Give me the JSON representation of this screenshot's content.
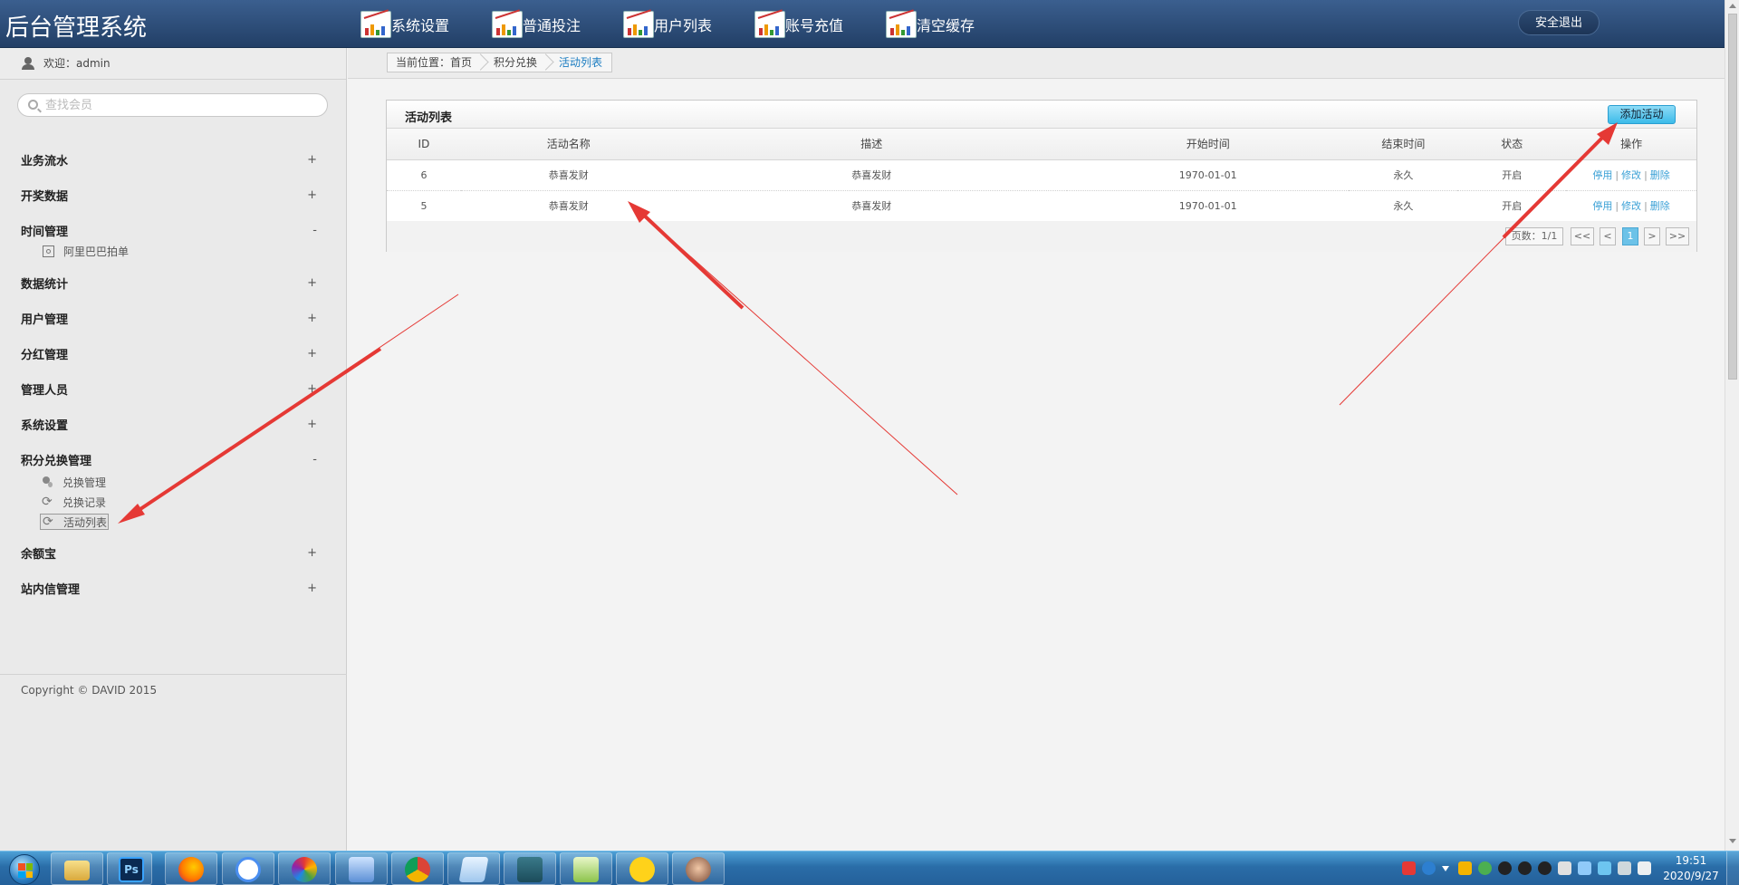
{
  "header": {
    "logo": "后台管理系统",
    "nav": [
      {
        "label": "系统设置"
      },
      {
        "label": "普通投注"
      },
      {
        "label": "用户列表"
      },
      {
        "label": "账号充值"
      },
      {
        "label": "清空缓存"
      }
    ],
    "logout_label": "安全退出"
  },
  "sidebar": {
    "welcome": "欢迎：admin",
    "search_placeholder": "查找会员",
    "menu": [
      {
        "label": "业务流水",
        "toggle": "+",
        "items": []
      },
      {
        "label": "开奖数据",
        "toggle": "+",
        "items": []
      },
      {
        "label": "时间管理",
        "toggle": "-",
        "items": [
          {
            "label": "阿里巴巴拍单",
            "icon": "target-icon"
          }
        ]
      },
      {
        "label": "数据统计",
        "toggle": "+",
        "items": []
      },
      {
        "label": "用户管理",
        "toggle": "+",
        "items": []
      },
      {
        "label": "分红管理",
        "toggle": "+",
        "items": []
      },
      {
        "label": "管理人员",
        "toggle": "+",
        "items": []
      },
      {
        "label": "系统设置",
        "toggle": "+",
        "items": []
      },
      {
        "label": "积分兑换管理",
        "toggle": "-",
        "items": [
          {
            "label": "兑换管理",
            "icon": "pin-icon"
          },
          {
            "label": "兑换记录",
            "icon": "refresh-icon"
          },
          {
            "label": "活动列表",
            "icon": "refresh-icon",
            "active": true
          }
        ]
      },
      {
        "label": "余额宝",
        "toggle": "+",
        "items": []
      },
      {
        "label": "站内信管理",
        "toggle": "+",
        "items": []
      }
    ],
    "copyright": "Copyright © DAVID 2015"
  },
  "breadcrumb": {
    "items": [
      "当前位置：首页",
      "积分兑换",
      "活动列表"
    ]
  },
  "panel": {
    "title": "活动列表",
    "add_button": "添加活动",
    "columns": [
      "ID",
      "活动名称",
      "描述",
      "开始时间",
      "结束时间",
      "状态",
      "操作"
    ],
    "rows": [
      {
        "id": "6",
        "name": "恭喜发财",
        "desc": "恭喜发财",
        "start": "1970-01-01",
        "end": "永久",
        "status": "开启",
        "ops": [
          "停用",
          "修改",
          "删除"
        ]
      },
      {
        "id": "5",
        "name": "恭喜发财",
        "desc": "恭喜发财",
        "start": "1970-01-01",
        "end": "永久",
        "status": "开启",
        "ops": [
          "停用",
          "修改",
          "删除"
        ]
      }
    ],
    "pager": {
      "info": "页数：1/1",
      "first": "<<",
      "prev": "<",
      "current": "1",
      "next": ">",
      "last": ">>"
    }
  },
  "taskbar": {
    "time": "19:51",
    "date": "2020/9/27"
  },
  "colors": {
    "header": "#2c4d7a",
    "accent": "#3cbbe9",
    "link": "#3ba1d6",
    "annotation_arrow": "#e53935"
  }
}
